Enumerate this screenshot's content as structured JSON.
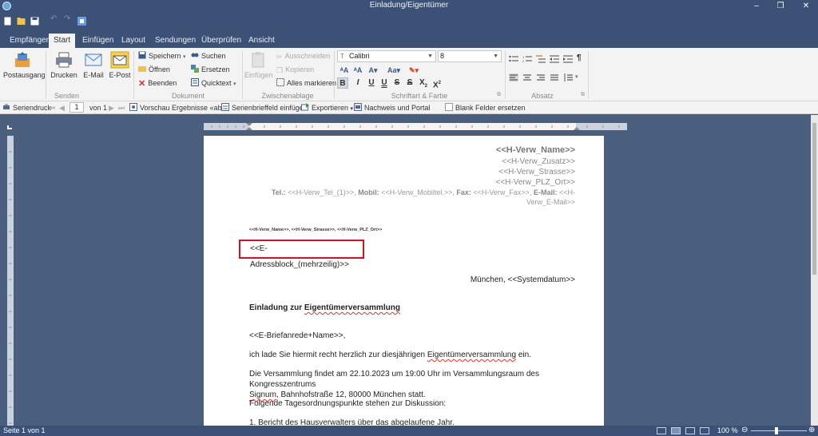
{
  "window": {
    "title": "Einladung/Eigentümer"
  },
  "tabs": [
    "Empfänger",
    "Start",
    "Einfügen",
    "Layout",
    "Sendungen",
    "Überprüfen",
    "Ansicht"
  ],
  "ribbon": {
    "senden": {
      "label": "Senden",
      "postausgang": "Postausgang",
      "drucken": "Drucken",
      "email": "E-Mail",
      "epost": "E-Post"
    },
    "dokument": {
      "label": "Dokument",
      "speichern": "Speichern",
      "oeffnen": "Öffnen",
      "beenden": "Beenden",
      "suchen": "Suchen",
      "ersetzen": "Ersetzen",
      "quicktext": "Quicktext"
    },
    "zwischenablage": {
      "label": "Zwischenablage",
      "einfuegen": "Einfügen",
      "ausschneiden": "Ausschneiden",
      "kopieren": "Kopieren",
      "alles_markieren": "Alles markieren"
    },
    "schrift": {
      "label": "Schriftart & Farbe",
      "font": "Calibri",
      "size": "8"
    },
    "absatz": {
      "label": "Absatz"
    }
  },
  "mergebar": {
    "serienbrief": "Seriendruck",
    "page": "1",
    "von": "von 1",
    "vorschau": "Vorschau Ergebnisse «abc»",
    "feld_einfuegen": "Serienbrieffeld einfügen",
    "exportieren": "Exportieren",
    "nachweis": "Nachweis und Portal",
    "blank": "Blank Felder ersetzen"
  },
  "document": {
    "sender_name": "<<H-Verw_Name>>",
    "sender_zusatz": "<<H-Verw_Zusatz>>",
    "sender_strasse": "<<H-Verw_Strasse>>",
    "sender_plz_ort": "<<H-Verw_PLZ_Ort>>",
    "tel_label": "Tel.:",
    "tel_value": "<<H-Verw_Tel_(1)>>,",
    "mobil_label": "Mobil:",
    "mobil_value": "<<H-Verw_Mobiltel.>>,",
    "fax_label": "Fax:",
    "fax_value": "<<H-Verw_Fax>>,",
    "email_label": "E-Mail:",
    "email_value": "<<H-Verw_E-Mail>>",
    "return_address": "<<H-Verw_Name>>, <<H-Verw_Strasse>>, <<H-Verw_PLZ_Ort>>",
    "address_block": "<<E-Adressblock_(mehrzeilig)>>",
    "date_line": "München, <<Systemdatum>>",
    "subject_prefix": "Einladung zur ",
    "subject_word": "Eigentümerversammlung",
    "salutation": "<<E-Briefanrede+Name>>,",
    "para1_prefix": "ich lade Sie hiermit recht herzlich zur diesjährigen ",
    "para1_word": "Eigentümerversammlung",
    "para1_suffix": " ein.",
    "para2_line1": "Die Versammlung findet am 22.10.2023 um 19:00 Uhr im Versammlungsraum des Kongresszentrums",
    "para2_word": "Signum",
    "para2_line2_suffix": ", Bahnhofstraße 12, 80000 München statt.",
    "para3": "Folgende Tagesordnungspunkte stehen zur Diskussion:",
    "item1": "1. Bericht des Hausverwalters über das abgelaufene Jahr."
  },
  "status": {
    "page_info": "Seite 1 von 1",
    "zoom": "100 %"
  }
}
